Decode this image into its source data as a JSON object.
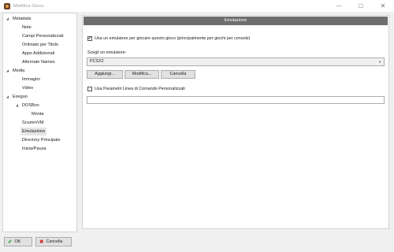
{
  "window": {
    "title": "Modifica Gioco",
    "minimize_icon": "—",
    "maximize_icon": "☐",
    "close_icon": "✕"
  },
  "tree": {
    "items": [
      {
        "label": "Metadata",
        "expanded": true
      },
      {
        "label": "Note"
      },
      {
        "label": "Campi Personalizzati"
      },
      {
        "label": "Ordinato per Titolo"
      },
      {
        "label": "Apps Addizionali"
      },
      {
        "label": "Alternate Names"
      },
      {
        "label": "Media",
        "expanded": true
      },
      {
        "label": "Immagini"
      },
      {
        "label": "Video"
      },
      {
        "label": "Eseguo",
        "expanded": true
      },
      {
        "label": "DOSBox",
        "expanded": true
      },
      {
        "label": "Monta"
      },
      {
        "label": "ScummVM"
      },
      {
        "label": "Emulazione",
        "selected": true
      },
      {
        "label": "Directory Principale"
      },
      {
        "label": "Inizia/Pausa"
      }
    ]
  },
  "emulation": {
    "header": "Emulazione",
    "use_emulator_label": "Usa un emulatore per giocare questo gioco (principalmente per giochi per console)",
    "use_emulator_checked": true,
    "choose_label": "Scegli un emulatore:",
    "selected_emulator": "PCSX2",
    "buttons": {
      "add": "Aggiungi...",
      "edit": "Modifica...",
      "delete": "Cancella"
    },
    "custom_cmd_label": "Usa Parametri Linea di Comando Personalizzati",
    "custom_cmd_checked": false,
    "custom_cmd_value": ""
  },
  "footer": {
    "ok": "OK",
    "cancel": "Cancella"
  },
  "colors": {
    "header_bg": "#6e6e6e",
    "ok_icon": "#2e9e2e",
    "cancel_icon": "#d03030"
  }
}
